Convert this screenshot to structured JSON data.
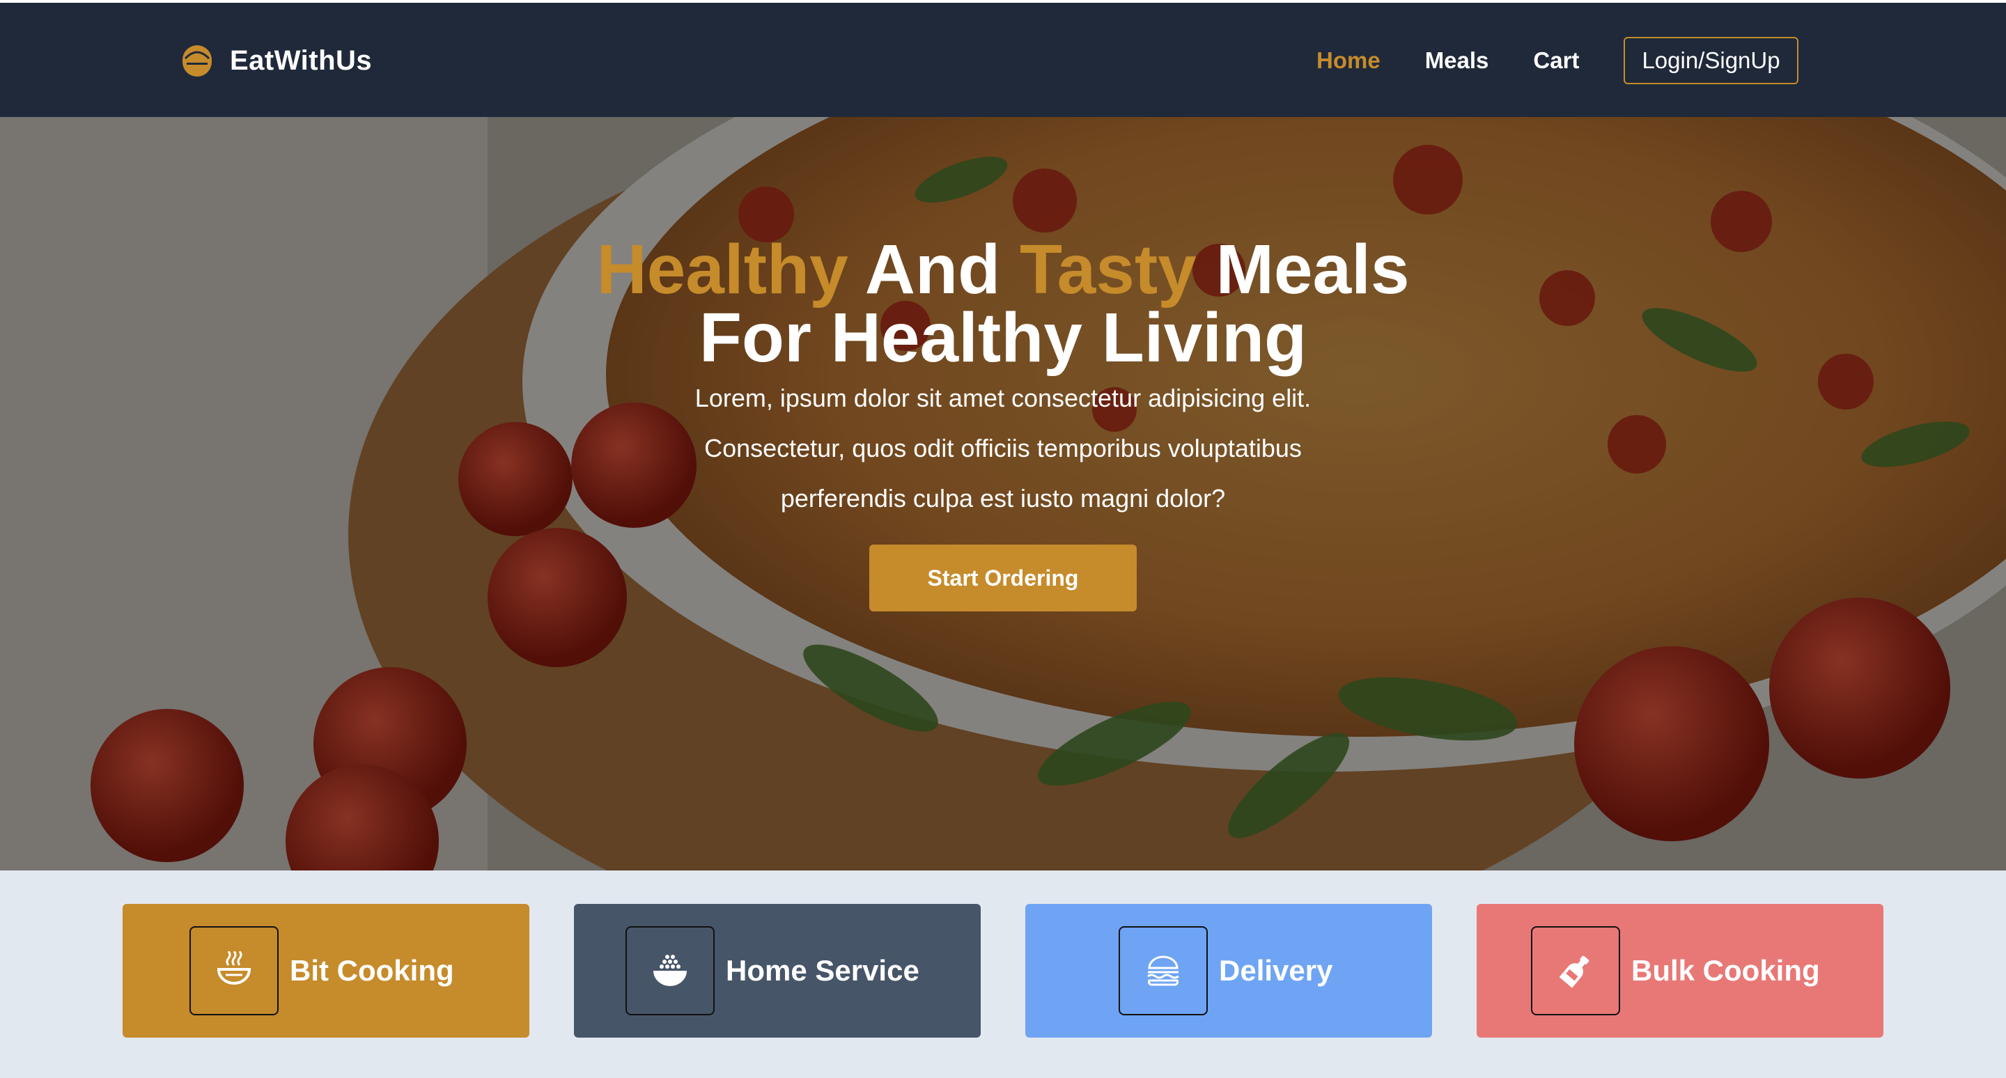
{
  "brand": {
    "name": "EatWithUs",
    "icon": "bowl-icon"
  },
  "nav": {
    "links": [
      {
        "label": "Home",
        "active": true
      },
      {
        "label": "Meals",
        "active": false
      },
      {
        "label": "Cart",
        "active": false
      }
    ],
    "login_label": "Login/SignUp"
  },
  "hero": {
    "title_parts": {
      "healthy": "Healthy",
      "and": "And",
      "tasty": "Tasty",
      "meals": "Meals",
      "line2": "For Healthy Living"
    },
    "subtitle_lines": [
      "Lorem, ipsum dolor sit amet consectetur adipisicing elit.",
      "Consectetur, quos odit officiis temporibus voluptatibus",
      "perferendis culpa est iusto magni dolor?"
    ],
    "cta_label": "Start Ordering",
    "background": "pizza-with-tomatoes-photo"
  },
  "services": [
    {
      "label": "Bit Cooking",
      "icon": "steaming-bowl-icon",
      "color": "#c68b2b"
    },
    {
      "label": "Home Service",
      "icon": "rice-bowl-icon",
      "color": "#475569"
    },
    {
      "label": "Delivery",
      "icon": "burger-icon",
      "color": "#6ea4f3"
    },
    {
      "label": "Bulk Cooking",
      "icon": "bottle-icon",
      "color": "#e87876"
    }
  ],
  "colors": {
    "accent": "#c68b2b",
    "nav_bg": "#1f293a",
    "page_bg": "#e2e8f0"
  }
}
